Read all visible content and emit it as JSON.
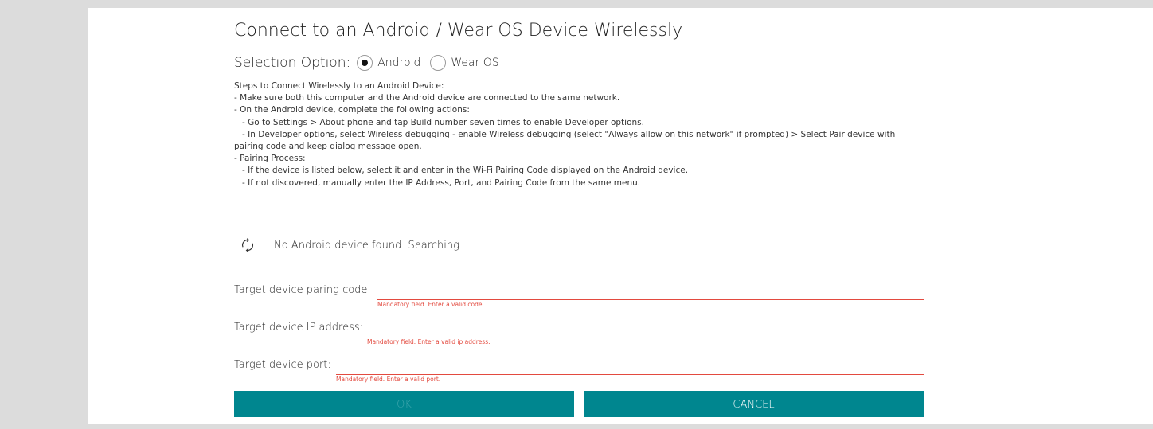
{
  "dialog": {
    "title": "Connect to an Android / Wear OS Device Wirelessly",
    "selection_label": "Selection Option:",
    "options": [
      {
        "label": "Android",
        "selected": true
      },
      {
        "label": "Wear OS",
        "selected": false
      }
    ],
    "steps": [
      "Steps to Connect Wirelessly to an Android Device:",
      "- Make sure both this computer and the Android device are connected to the same network.",
      "- On the Android device, complete the following actions:",
      "   - Go to Settings > About phone and tap Build number seven times to enable Developer options.",
      "   - In Developer options, select Wireless debugging - enable Wireless debugging (select \"Always allow on this network\" if prompted) > Select Pair device with pairing code and keep dialog message open.",
      "- Pairing Process:",
      "   - If the device is listed below, select it and enter in the Wi-Fi Pairing Code displayed on the Android device.",
      "   - If not discovered, manually enter the IP Address, Port, and Pairing Code from the same menu."
    ],
    "status": {
      "icon": "refresh-icon",
      "text": "No Android device found. Searching..."
    },
    "fields": {
      "pairing_code": {
        "label": "Target device paring code:",
        "value": "",
        "error": "Mandatory field. Enter a valid code."
      },
      "ip_address": {
        "label": "Target device IP address:",
        "value": "",
        "error": "Mandatory field. Enter a valid ip address."
      },
      "port": {
        "label": "Target device port:",
        "value": "",
        "error": "Mandatory field. Enter a valid port."
      }
    },
    "buttons": {
      "ok_label": "OK",
      "ok_disabled": true,
      "cancel_label": "CANCEL"
    },
    "colors": {
      "accent": "#00868f",
      "error": "#e34a3f",
      "background": "#dcdcdc"
    }
  }
}
